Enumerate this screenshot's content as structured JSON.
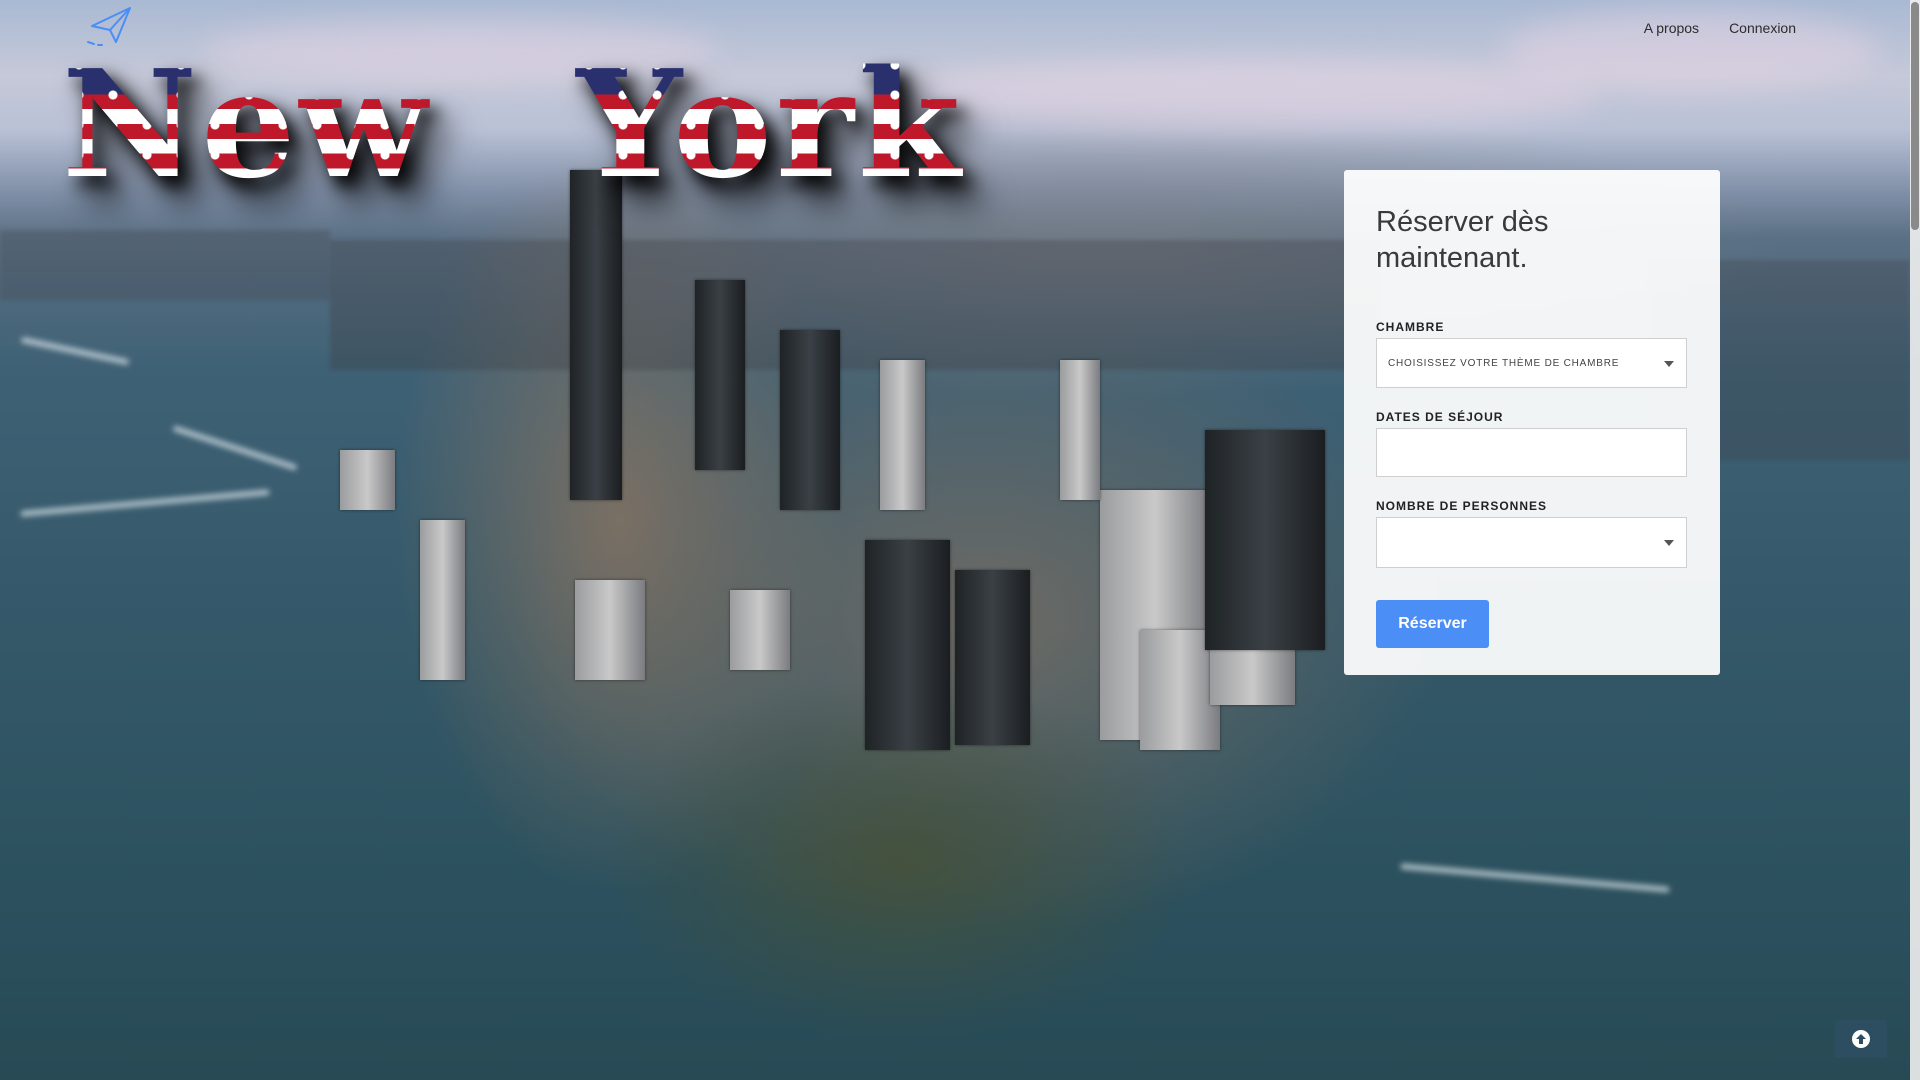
{
  "nav": {
    "about": "A propos",
    "login": "Connexion"
  },
  "hero": {
    "title": "New York"
  },
  "booking": {
    "heading": "Réserver dès maintenant.",
    "room_label": "CHAMBRE",
    "room_value": "CHOISISSEZ VOTRE THÈME DE CHAMBRE",
    "dates_label": "DATES DE SÉJOUR",
    "dates_value": "",
    "people_label": "NOMBRE DE PERSONNES",
    "people_value": "",
    "submit_label": "Réserver"
  },
  "colors": {
    "accent": "#4a8ef6",
    "scroll_top_bg": "#2d4e60",
    "flag_blue": "#2a2f6e",
    "flag_red": "#c0182b"
  },
  "icons": {
    "logo": "paper-plane-icon",
    "scroll_top": "arrow-up-circle-icon",
    "dropdown": "caret-down-icon"
  }
}
